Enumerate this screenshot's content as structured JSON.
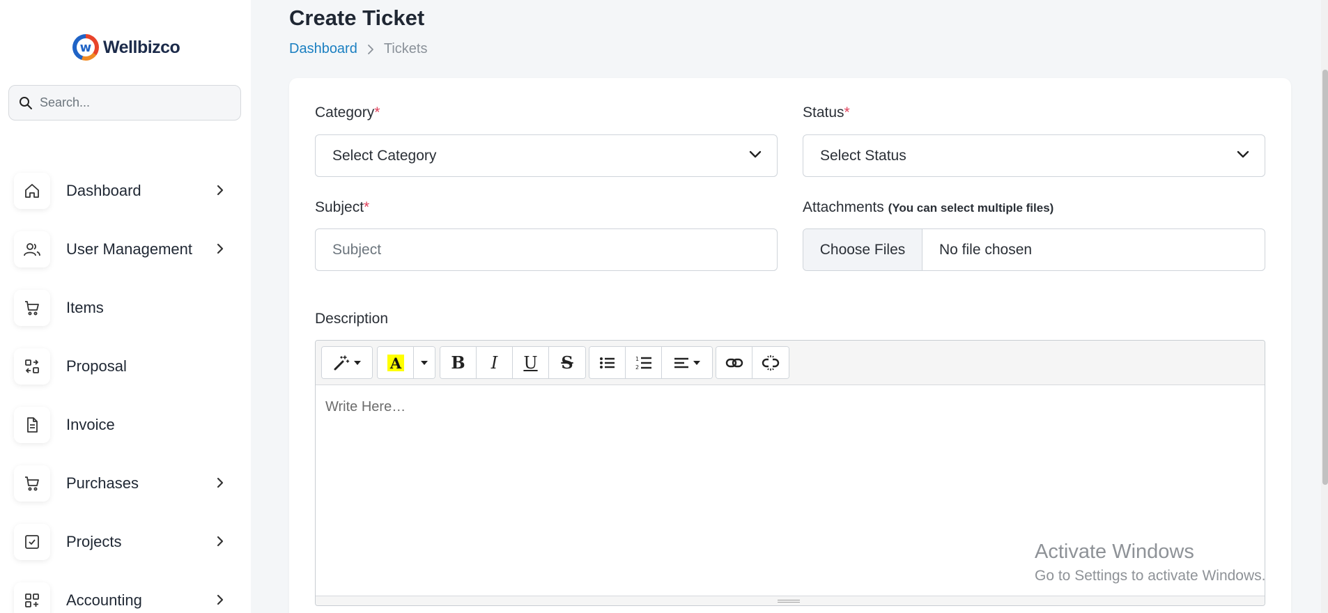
{
  "brand": {
    "name": "Wellbizco",
    "logo_letter": "w"
  },
  "search": {
    "placeholder": "Search..."
  },
  "sidebar": {
    "items": [
      {
        "label": "Dashboard",
        "icon": "home-icon",
        "has_submenu": true
      },
      {
        "label": "User Management",
        "icon": "users-icon",
        "has_submenu": true
      },
      {
        "label": "Items",
        "icon": "cart-icon",
        "has_submenu": false
      },
      {
        "label": "Proposal",
        "icon": "swap-icon",
        "has_submenu": false
      },
      {
        "label": "Invoice",
        "icon": "document-icon",
        "has_submenu": false
      },
      {
        "label": "Purchases",
        "icon": "cart-icon",
        "has_submenu": true
      },
      {
        "label": "Projects",
        "icon": "checkbox-icon",
        "has_submenu": true
      },
      {
        "label": "Accounting",
        "icon": "grid-plus-icon",
        "has_submenu": true
      }
    ]
  },
  "page": {
    "title": "Create Ticket",
    "breadcrumb": {
      "home": "Dashboard",
      "separator": ">",
      "current": "Tickets"
    }
  },
  "form": {
    "category": {
      "label": "Category",
      "required_mark": "*",
      "value": "Select Category"
    },
    "status": {
      "label": "Status",
      "required_mark": "*",
      "value": "Select Status"
    },
    "subject": {
      "label": "Subject",
      "required_mark": "*",
      "placeholder": "Subject"
    },
    "attachments": {
      "label": "Attachments",
      "hint": "(You can select multiple files)",
      "button": "Choose Files",
      "status": "No file chosen"
    },
    "description": {
      "label": "Description",
      "placeholder": "Write Here…"
    }
  },
  "editor_toolbar": [
    "magic-style",
    "highlight-color",
    "color-dropdown",
    "bold",
    "italic",
    "underline",
    "strikethrough",
    "unordered-list",
    "ordered-list",
    "paragraph-align",
    "link",
    "unlink"
  ],
  "watermark": {
    "title": "Activate Windows",
    "subtitle": "Go to Settings to activate Windows."
  },
  "colors": {
    "link": "#1a7fc1",
    "required": "#e0415b",
    "highlight": "#ffff00"
  }
}
